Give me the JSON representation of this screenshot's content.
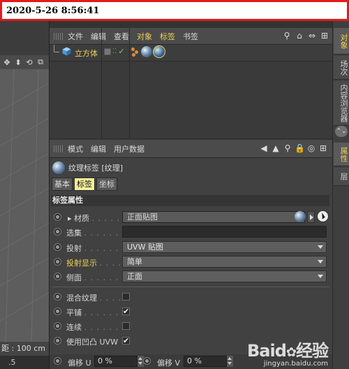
{
  "timestamp": "2020-5-26 8:56:41",
  "viewport": {
    "toolbar_icons": [
      "move-icon",
      "down-arrow-icon",
      "rotate-icon",
      "layout-icon"
    ],
    "toolbar_glyphs": [
      "✥",
      "⬍",
      "⟲",
      "⧉"
    ],
    "status": "距 : 100 cm",
    "bottom_value": ".5"
  },
  "object_manager": {
    "menu": [
      "文件",
      "编辑",
      "查看",
      "对象",
      "标签",
      "书签"
    ],
    "highlight_menu": [
      "对象",
      "标签"
    ],
    "toolbar_glyphs": [
      "⚲",
      "⌂",
      "⇔",
      "⊞"
    ],
    "objects": [
      {
        "name": "立方体"
      }
    ]
  },
  "right_strip": {
    "tabs_top": [
      "对象",
      "场次",
      "内容浏览器"
    ],
    "tabs_bottom": [
      "属性",
      "层"
    ],
    "toggle_glyph": "⌃⌄"
  },
  "attribute_manager": {
    "menu": [
      "模式",
      "编辑",
      "用户数据"
    ],
    "toolbar_glyphs": [
      "◀",
      "▲",
      "⚲",
      "🔒",
      "◎",
      "⊞"
    ],
    "title": "纹理标签 [纹理]",
    "tabs": [
      "基本",
      "标签",
      "坐标"
    ],
    "active_tab": "标签",
    "section": "标签属性",
    "props": {
      "material": {
        "label": "材质",
        "dots": ". . . . . . . .",
        "value": "正面贴图"
      },
      "selection": {
        "label": "选集",
        "dots": ". . . . . . . .",
        "value": ""
      },
      "projection": {
        "label": "投射",
        "dots": ". . . . . . . . .",
        "value": "UVW 贴图"
      },
      "projection_display": {
        "label": "投射显示",
        "dots": ". . . . .",
        "value": "简单"
      },
      "side": {
        "label": "侧面",
        "dots": ". . . . . . . .",
        "value": "正面"
      },
      "mix_texture": {
        "label": "混合纹理",
        "dots": ". . . . .",
        "checked": ""
      },
      "tile": {
        "label": "平铺",
        "dots": ". . . . . . . . .",
        "checked": "✔"
      },
      "seamless": {
        "label": "连续",
        "dots": ". . . . . . . . .",
        "checked": ""
      },
      "use_bump_uvw": {
        "label": "使用凹凸 UVW",
        "dots": "",
        "checked": "✔"
      }
    },
    "offset_u": {
      "label": "偏移 U",
      "value": "0 %"
    },
    "offset_v": {
      "label": "偏移 V",
      "value": "0 %"
    }
  },
  "watermark": {
    "logo": "Baid",
    "logo_tail": "经验",
    "url": "jingyan.baidu.com"
  },
  "colors": {
    "accent": "#f0cf54",
    "date_border": "#e21b1b",
    "active_tab_bg": "#f6ef9a"
  }
}
